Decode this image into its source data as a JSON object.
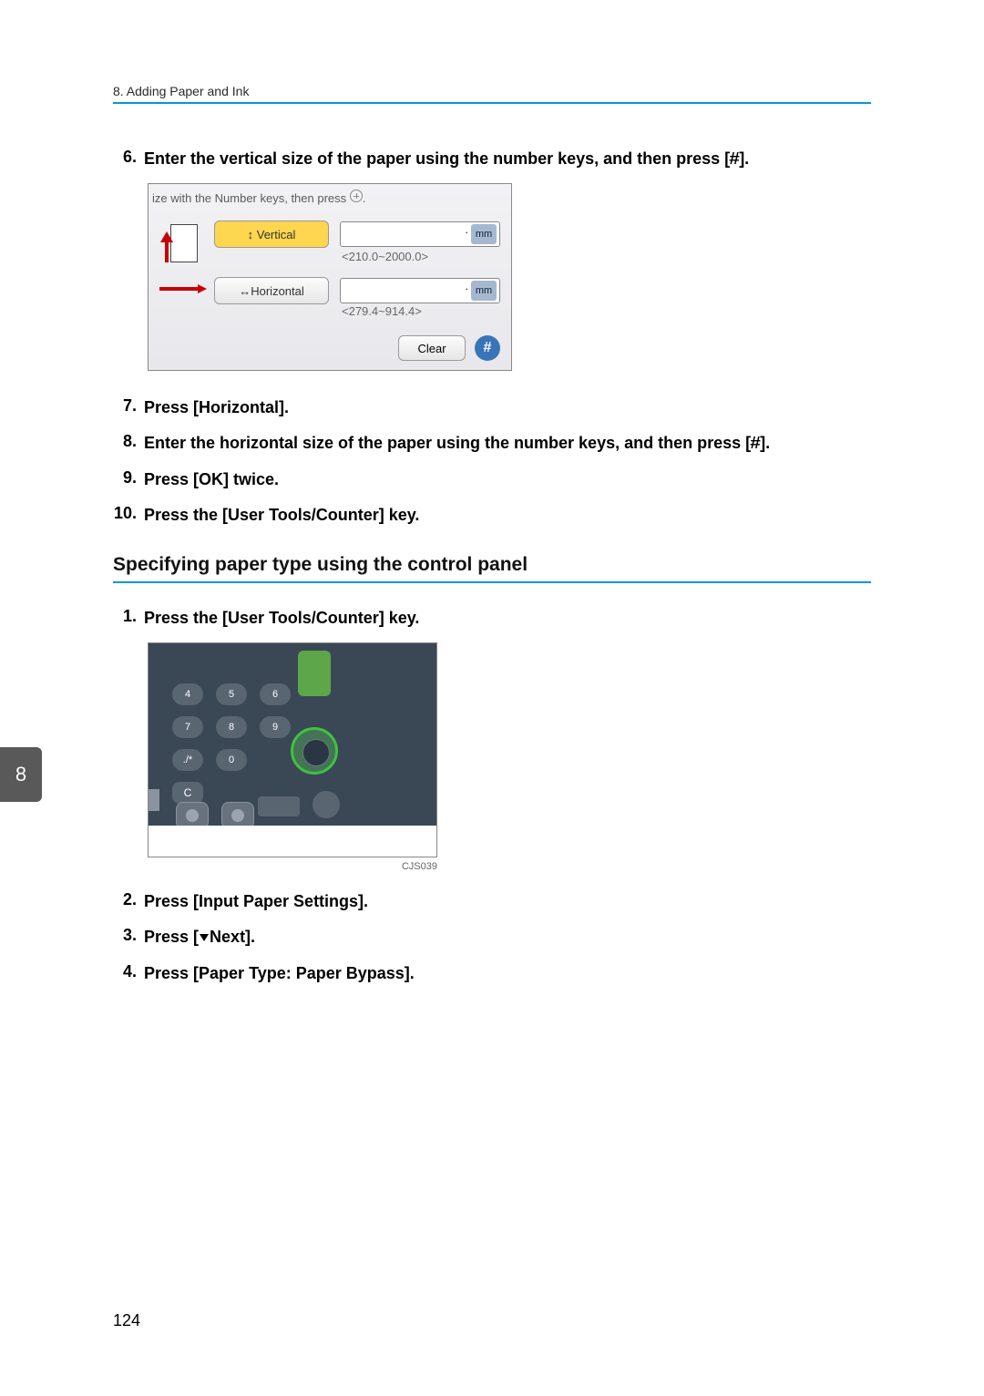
{
  "running_header": "8. Adding Paper and Ink",
  "step6": {
    "num": "6.",
    "text_a": "Enter the vertical size of the paper using the number keys, and then press [",
    "text_b": "]."
  },
  "hash_symbol": "#",
  "panel1": {
    "hint_prefix": "ize with the Number keys, then press ",
    "hint_suffix": ".",
    "vertical_label": "↕ Vertical",
    "horizontal_label": "↔Horizontal",
    "value_display_v": ".",
    "value_display_h": ".",
    "unit": "mm",
    "range_v": "<210.0~2000.0>",
    "range_h": "<279.4~914.4>",
    "clear_label": "Clear"
  },
  "step7": {
    "num": "7.",
    "text": "Press [Horizontal]."
  },
  "step8": {
    "num": "8.",
    "text_a": "Enter the horizontal size of the paper using the number keys, and then press [",
    "text_b": "]."
  },
  "step9": {
    "num": "9.",
    "text": "Press [OK] twice."
  },
  "step10": {
    "num": "10.",
    "text": "Press the [User Tools/Counter] key."
  },
  "section_heading": "Specifying paper type using the control panel",
  "stepA1": {
    "num": "1.",
    "text": "Press the [User Tools/Counter] key."
  },
  "panel2": {
    "keys": [
      "",
      "",
      "",
      "",
      "4",
      "5",
      "6",
      "",
      "7",
      "8",
      "9",
      "",
      "./*",
      "0",
      "",
      "",
      "C",
      "",
      "",
      ""
    ],
    "caption": "CJS039"
  },
  "stepA2": {
    "num": "2.",
    "text": "Press [Input Paper Settings]."
  },
  "stepA3": {
    "num": "3.",
    "text_a": "Press [",
    "text_b": "Next]."
  },
  "stepA4": {
    "num": "4.",
    "text": "Press [Paper Type: Paper Bypass]."
  },
  "chapter_tab": "8",
  "page_number": "124"
}
